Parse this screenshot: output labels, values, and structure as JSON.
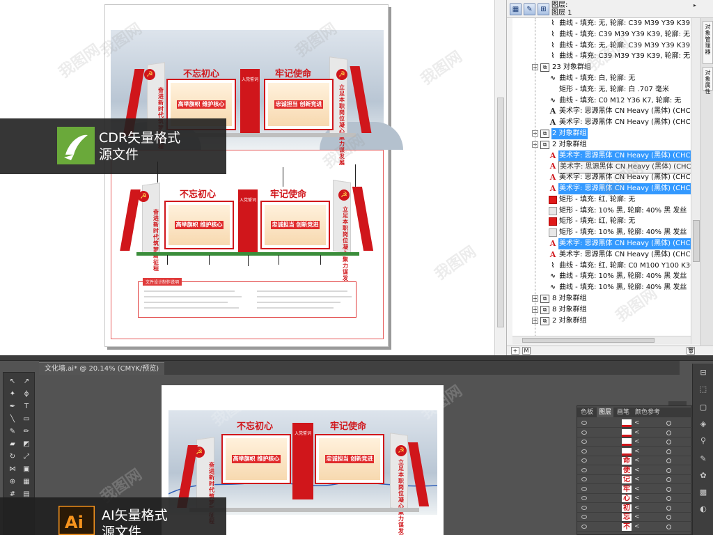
{
  "badges": {
    "cdr": {
      "line1": "CDR矢量格式",
      "line2": "源文件"
    },
    "ai": {
      "line1": "AI矢量格式",
      "line2": "源文件"
    }
  },
  "watermark": "我图网",
  "design": {
    "title_left": "不忘初心",
    "title_right": "牢记使命",
    "panel_left": "高举旗帜 维护核心",
    "panel_right": "忠诚担当 创新竞进",
    "center_header": "入党誓词",
    "wing_left_vertical": "奋进新时代 筑梦新征程",
    "wing_right_vertical": "立足本职岗位 凝心聚力谋发展",
    "notes_tag": "文件设计制作说明"
  },
  "object_manager": {
    "layer_label": "图层:",
    "layer_name": "图层 1",
    "side_tabs": [
      "对象管理器",
      "对象属性"
    ],
    "rows": [
      {
        "icon": "curve-icon",
        "text": "曲线 - 填充: 无, 轮廓: C39 M39 Y39 K39, 发丝",
        "indent": 2,
        "sel": false
      },
      {
        "icon": "curve-icon",
        "text": "曲线 - 填充: C39 M39 Y39 K39, 轮廓: 无",
        "indent": 2,
        "sel": false
      },
      {
        "icon": "curve-icon",
        "text": "曲线 - 填充: 无, 轮廓: C39 M39 Y39 K39, 发丝",
        "indent": 2,
        "sel": false
      },
      {
        "icon": "curve-icon",
        "text": "曲线 - 填充: C39 M39 Y39 K39, 轮廓: 无",
        "indent": 2,
        "sel": false
      },
      {
        "icon": "group-icon",
        "text": "23 对象群组",
        "indent": 1,
        "sel": false
      },
      {
        "icon": "curve-outline-icon",
        "text": "曲线 - 填充: 白, 轮廓: 无",
        "indent": 2,
        "sel": false
      },
      {
        "icon": "none",
        "text": "矩形 - 填充: 无, 轮廓: 白 .707 毫米",
        "indent": 2,
        "sel": false
      },
      {
        "icon": "curve-outline-icon",
        "text": "曲线 - 填充: C0 M12 Y36 K7, 轮廓: 无",
        "indent": 2,
        "sel": false
      },
      {
        "icon": "artistic-text-icon",
        "text": "美术字: 思源黑体 CN Heavy (黑体) (CHC) -",
        "indent": 2,
        "sel": false
      },
      {
        "icon": "artistic-text-icon",
        "text": "美术字: 思源黑体 CN Heavy (黑体) (CHC) -",
        "indent": 2,
        "sel": false
      },
      {
        "icon": "group-icon",
        "text": "2 对象群组",
        "indent": 1,
        "sel": true
      },
      {
        "icon": "group-icon",
        "text": "2 对象群组",
        "indent": 1,
        "sel": false
      },
      {
        "icon": "artistic-text-red-icon",
        "text": "美术字: 思源黑体 CN Heavy (黑体) (CHC) -",
        "indent": 2,
        "sel": true
      },
      {
        "icon": "artistic-text-red-icon",
        "text": "美术字: 思源黑体 CN Heavy (黑体) (CHC) - 填充: 红",
        "indent": 2,
        "sel": false,
        "tooltip": true
      },
      {
        "icon": "artistic-text-red-icon",
        "text": "美术字: 思源黑体 CN Heavy (黑体) (CHC) -",
        "indent": 2,
        "sel": false
      },
      {
        "icon": "artistic-text-red-icon",
        "text": "美术字: 思源黑体 CN Heavy (黑体) (CHC) -",
        "indent": 2,
        "sel": true
      },
      {
        "icon": "red-rect-icon",
        "text": "矩形 - 填充: 红, 轮廓: 无",
        "indent": 2,
        "sel": false
      },
      {
        "icon": "grey-rect-icon",
        "text": "矩形 - 填充: 10% 黑, 轮廓: 40% 黑 发丝",
        "indent": 2,
        "sel": false
      },
      {
        "icon": "red-rect-icon",
        "text": "矩形 - 填充: 红, 轮廓: 无",
        "indent": 2,
        "sel": false
      },
      {
        "icon": "grey-rect-icon",
        "text": "矩形 - 填充: 10% 黑, 轮廓: 40% 黑 发丝",
        "indent": 2,
        "sel": false
      },
      {
        "icon": "artistic-text-red-icon",
        "text": "美术字: 思源黑体 CN Heavy (黑体) (CHC) -",
        "indent": 2,
        "sel": true
      },
      {
        "icon": "artistic-text-red-icon",
        "text": "美术字: 思源黑体 CN Heavy (黑体) (CHC) -",
        "indent": 2,
        "sel": false
      },
      {
        "icon": "curve-icon",
        "text": "曲线 - 填充: 红, 轮廓: C0 M100 Y100 K30 发",
        "indent": 2,
        "sel": false
      },
      {
        "icon": "curve-outline-icon",
        "text": "曲线 - 填充: 10% 黑, 轮廓: 40% 黑 发丝",
        "indent": 2,
        "sel": false
      },
      {
        "icon": "curve-outline-icon",
        "text": "曲线 - 填充: 10% 黑, 轮廓: 40% 黑 发丝",
        "indent": 2,
        "sel": false
      },
      {
        "icon": "group-icon",
        "text": "8 对象群组",
        "indent": 1,
        "sel": false
      },
      {
        "icon": "group-icon",
        "text": "8 对象群组",
        "indent": 1,
        "sel": false
      },
      {
        "icon": "group-icon",
        "text": "2 对象群组",
        "indent": 1,
        "sel": false
      }
    ]
  },
  "illustrator": {
    "doc_tab": "文化墙.ai* @ 20.14% (CMYK/预览)",
    "panel_tabs": [
      "色板",
      "图层",
      "画笔",
      "颜色参考"
    ],
    "layer_thumbs": [
      "",
      "",
      "",
      "",
      "命",
      "使",
      "记",
      "牢",
      "心",
      "初",
      "忘",
      "不"
    ]
  }
}
